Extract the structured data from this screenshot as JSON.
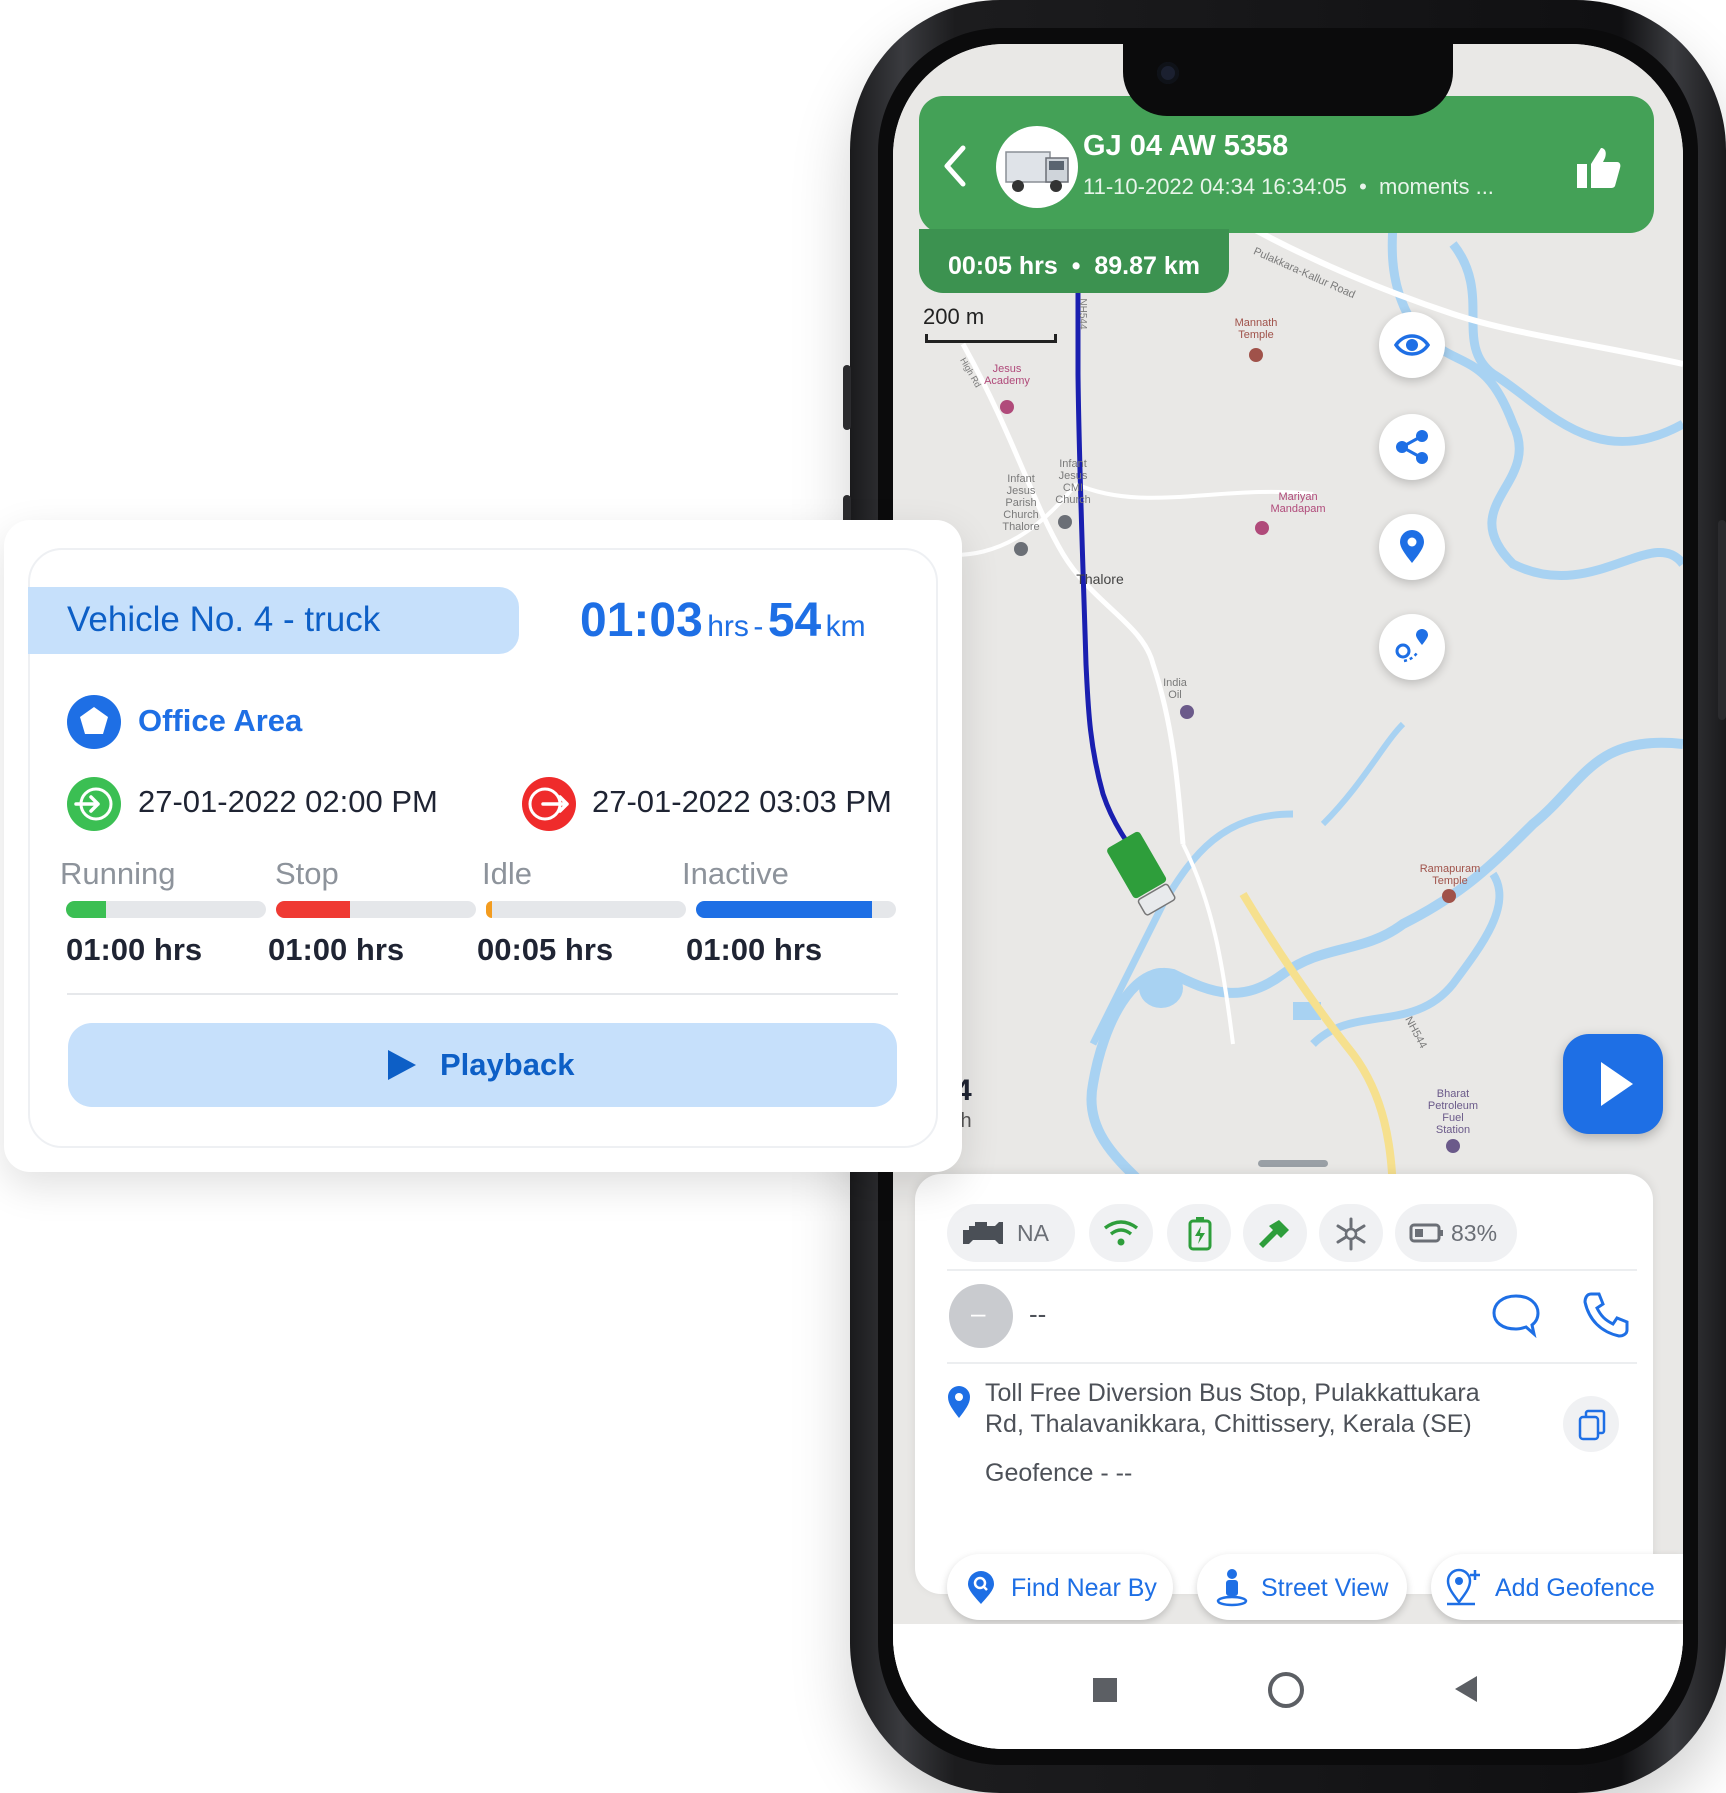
{
  "card": {
    "vehicle_label": "Vehicle No. 4 - truck",
    "duration_value": "01:03",
    "duration_unit": "hrs",
    "separator": "-",
    "distance_value": "54",
    "distance_unit": "km",
    "geofence_name": "Office Area",
    "entry_time": "27-01-2022 02:00 PM",
    "exit_time": "27-01-2022 03:03 PM",
    "stats": [
      {
        "label": "Running",
        "value": "01:00 hrs",
        "color": "#3bbf53",
        "fill": 0.2
      },
      {
        "label": "Stop",
        "value": "01:00 hrs",
        "color": "#ef3a33",
        "fill": 0.37
      },
      {
        "label": "Idle",
        "value": "00:05 hrs",
        "color": "#f39c1f",
        "fill": 0.03
      },
      {
        "label": "Inactive",
        "value": "01:00 hrs",
        "color": "#1e6fe5",
        "fill": 0.88
      }
    ],
    "playback_label": "Playback"
  },
  "phone": {
    "header": {
      "plate": "GJ 04 AW 5358",
      "timestamp": "11-10-2022 04:34 16:34:05",
      "status": "moments ...",
      "duration": "00:05 hrs",
      "distance": "89.87 km"
    },
    "map": {
      "scale": "200 m",
      "places": [
        {
          "name": "Jesus\nAcademy"
        },
        {
          "name": "Mannath\nTemple"
        },
        {
          "name": "Infant\nJesus\nCMI\nChurch"
        },
        {
          "name": "Infant\nJesus\nParish\nChurch\nThalore"
        },
        {
          "name": "Mariyan\nMandapam"
        },
        {
          "name": "Thalore"
        },
        {
          "name": "India\nOil"
        },
        {
          "name": "Ramapuram\nTemple"
        },
        {
          "name": "Bharat\nPetroleum\nFuel\nStation"
        }
      ],
      "roads": [
        "Pulakkara-Kallur Road",
        "NH544",
        "NH544",
        "High Rd"
      ],
      "speed_value": "4",
      "speed_unit": "/h"
    },
    "status_chips": {
      "engine": "NA",
      "battery_percent": "83%"
    },
    "driver": {
      "avatar_text": "–",
      "name": "--"
    },
    "address": "Toll Free Diversion Bus Stop, Pulakkattukara Rd, Thalavanikkara, Chittissery, Kerala (SE)",
    "geofence": "Geofence - --",
    "actions": {
      "find_near_by": "Find Near By",
      "street_view": "Street View",
      "add_geofence": "Add Geofence"
    },
    "colors": {
      "header_green": "#44a157",
      "accent_blue": "#1e6fe5",
      "route_blue": "#1a1fb0",
      "truck_green": "#2e9e3b"
    }
  }
}
